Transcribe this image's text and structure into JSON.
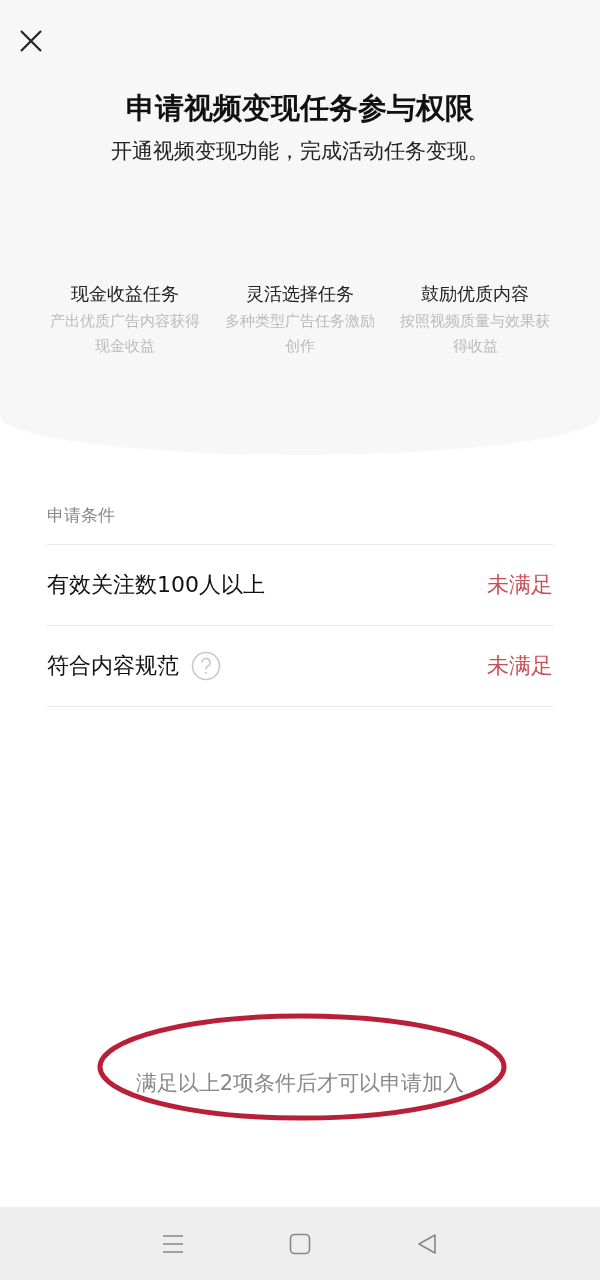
{
  "header": {
    "title": "申请视频变现任务参与权限",
    "subtitle": "开通视频变现功能，完成活动任务变现。"
  },
  "features": [
    {
      "title": "现金收益任务",
      "description": "产出优质广告内容获得现金收益"
    },
    {
      "title": "灵活选择任务",
      "description": "多种类型广告任务激励创作"
    },
    {
      "title": "鼓励优质内容",
      "description": "按照视频质量与效果获得收益"
    }
  ],
  "conditions": {
    "heading": "申请条件",
    "items": [
      {
        "label": "有效关注数100人以上",
        "status": "未满足",
        "met": false,
        "help": false
      },
      {
        "label": "符合内容规范",
        "status": "未满足",
        "met": false,
        "help": true
      }
    ]
  },
  "footer_note": {
    "text": "满足以上2项条件后才可以申请加入",
    "circled": true
  }
}
